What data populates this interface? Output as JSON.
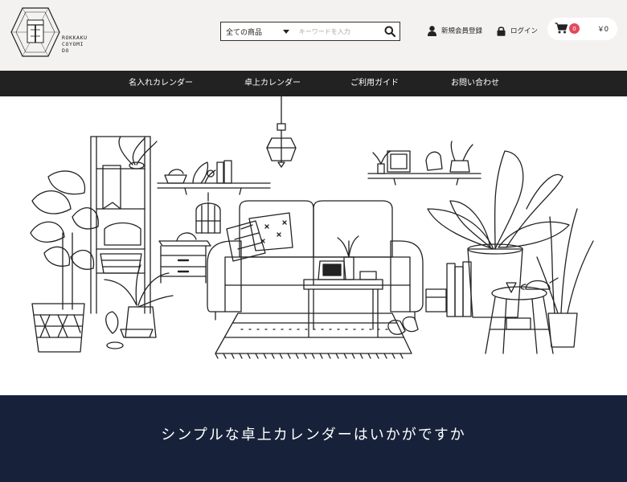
{
  "header": {
    "logo_text": [
      "ROKKAKU",
      "COYOMI",
      "DO"
    ],
    "search": {
      "category": "全ての商品",
      "placeholder": "キーワードを入力"
    },
    "signup_label": "新規会員登録",
    "login_label": "ログイン",
    "cart": {
      "count": "0",
      "total": "￥0"
    }
  },
  "nav": {
    "items": [
      {
        "label": "名入れカレンダー"
      },
      {
        "label": "卓上カレンダー"
      },
      {
        "label": "ご利用ガイド"
      },
      {
        "label": "お問い合わせ"
      }
    ]
  },
  "banner": {
    "text": "シンプルな卓上カレンダーはいかがですか"
  },
  "colors": {
    "header_bg": "#f3f2f0",
    "nav_bg": "#222222",
    "banner_bg": "#17223a",
    "badge": "#e24a5b"
  },
  "icons": [
    "logo-hexagon-icon",
    "caret-down-icon",
    "search-icon",
    "user-icon",
    "lock-icon",
    "cart-icon"
  ],
  "hero_illustration": "living-room-line-drawing"
}
